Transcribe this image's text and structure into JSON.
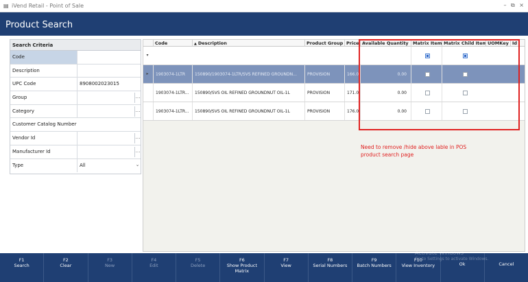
{
  "window": {
    "title": "iVend Retail - Point of Sale",
    "controls": "– ⧉ ×"
  },
  "header": {
    "title": "Product Search"
  },
  "criteria": {
    "heading": "Search Criteria",
    "rows": [
      {
        "label": "Code",
        "value": ""
      },
      {
        "label": "Description",
        "value": ""
      },
      {
        "label": "UPC Code",
        "value": "8908002023015"
      },
      {
        "label": "Group",
        "value": ""
      },
      {
        "label": "Category",
        "value": ""
      },
      {
        "label": "Customer Catalog Number",
        "value": ""
      },
      {
        "label": "Vendor Id",
        "value": ""
      },
      {
        "label": "Manufacturer Id",
        "value": ""
      },
      {
        "label": "Type",
        "value": "All"
      }
    ]
  },
  "grid": {
    "columns": [
      "Code",
      "Description",
      "Product Group",
      "Price",
      "Available Quantity",
      "Matrix Item",
      "Matrix Child Item",
      "UOMKey",
      "Id"
    ],
    "sort_indicator": "▲",
    "rows": [
      {
        "code": "1903074-1LTR",
        "description": "150890/1903074-1LTR/SVS REFINED GROUNDN...",
        "group": "PROVISION",
        "price": "166.00",
        "qty": "0.00"
      },
      {
        "code": "1903074-1LTR...",
        "description": "150890/SVS OIL REFINED GROUNDNUT OIL-1L",
        "group": "PROVISION",
        "price": "171.00",
        "qty": "0.00"
      },
      {
        "code": "1903074-1LTR...",
        "description": "150890/SVS OIL REFINED GROUNDNUT OIL-1L",
        "group": "PROVISION",
        "price": "176.00",
        "qty": "0.00"
      }
    ]
  },
  "annotation": {
    "text": "Need to remove /hide above lable in POS product search page"
  },
  "toolbar": [
    {
      "key": "F1",
      "label": "Search",
      "enabled": true
    },
    {
      "key": "F2",
      "label": "Clear",
      "enabled": true
    },
    {
      "key": "F3",
      "label": "New",
      "enabled": false
    },
    {
      "key": "F4",
      "label": "Edit",
      "enabled": false
    },
    {
      "key": "F5",
      "label": "Delete",
      "enabled": false
    },
    {
      "key": "F6",
      "label": "Show Product Matrix",
      "enabled": true
    },
    {
      "key": "F7",
      "label": "View",
      "enabled": true
    },
    {
      "key": "F8",
      "label": "Serial Numbers",
      "enabled": true
    },
    {
      "key": "F9",
      "label": "Batch Numbers",
      "enabled": true
    },
    {
      "key": "F10",
      "label": "View Inventory",
      "enabled": true
    },
    {
      "key": "",
      "label": "Ok",
      "enabled": true
    },
    {
      "key": "",
      "label": "Cancel",
      "enabled": true
    }
  ],
  "watermark": {
    "line1": "Activate Windows",
    "line2": "Go to Settings to activate Windows."
  },
  "colors": {
    "header": "#1f3f73",
    "selected_row": "#7d93bb",
    "annotation": "#e02020"
  }
}
